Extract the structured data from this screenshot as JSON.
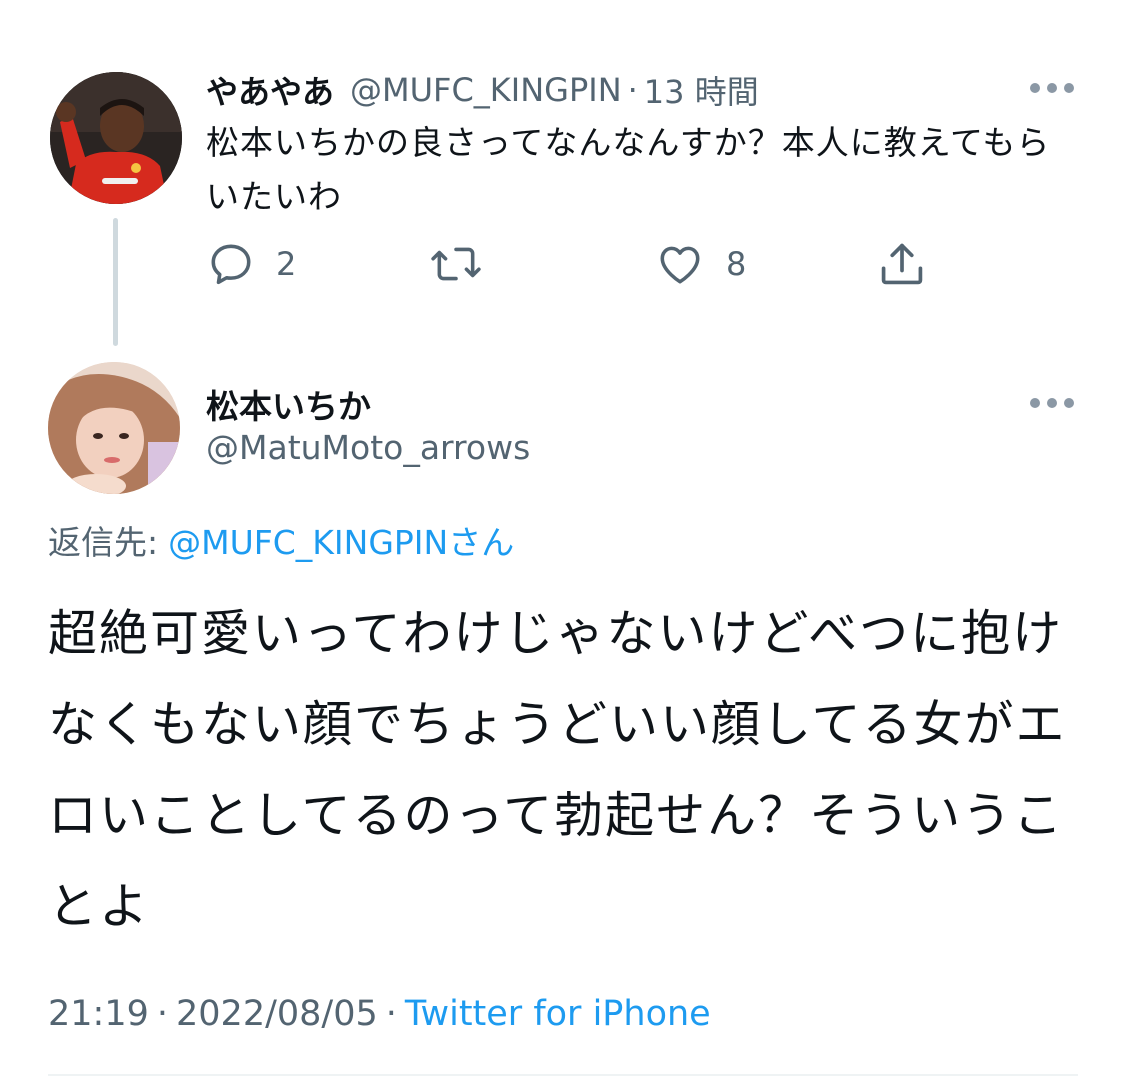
{
  "parent_tweet": {
    "display_name": "やあやあ",
    "handle": "@MUFC_KINGPIN",
    "separator": "·",
    "time": "13 時間",
    "text": "松本いちかの良さってなんなんすか？本人に教えてもらいたいわ",
    "avatar_icon": "profile-photo-red-jersey",
    "actions": {
      "reply_icon": "reply-bubble-icon",
      "reply_count": "2",
      "retweet_icon": "retweet-icon",
      "retweet_count": "",
      "like_icon": "heart-icon",
      "like_count": "8",
      "share_icon": "share-icon"
    }
  },
  "reply_tweet": {
    "display_name": "松本いちか",
    "handle": "@MatuMoto_arrows",
    "avatar_icon": "profile-photo-portrait",
    "replying_to_label": "返信先:",
    "replying_to_mention": "@MUFC_KINGPINさん",
    "text": "超絶可愛いってわけじゃないけどべつに抱けなくもない顔でちょうどいい顔してる女がエロいことしてるのって勃起せん？そういうことよ",
    "time": "21:19",
    "separator": "·",
    "date": "2022/08/05",
    "source": "Twitter for iPhone"
  },
  "colors": {
    "primary_text": "#0f1419",
    "secondary_text": "#536471",
    "accent_link": "#1d9bf0",
    "thread_line": "#cfd9de"
  }
}
